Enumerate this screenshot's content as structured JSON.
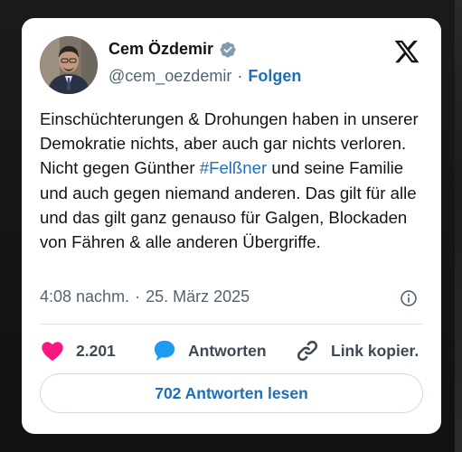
{
  "tweet": {
    "author_name": "Cem Özdemir",
    "handle": "@cem_oezdemir",
    "separator": "·",
    "follow_label": "Folgen",
    "text_before_hashtag": "Einschüchterungen & Drohungen haben in unserer Demokratie nichts, aber auch gar nichts verloren. Nicht gegen Günther ",
    "hashtag": "#Felßner",
    "text_after_hashtag": " und seine Familie und auch gegen niemand anderen. Das gilt für alle und das gilt ganz genauso für Galgen, Blockaden von Fähren & alle anderen Übergriffe.",
    "time": "4:08 nachm.",
    "date": "25. März 2025"
  },
  "actions": {
    "like_count": "2.201",
    "reply_label": "Antworten",
    "link_label": "Link kopier."
  },
  "read_replies_label": "702 Antworten lesen",
  "colors": {
    "accent": "#1d6fb8",
    "like": "#f91880",
    "verified": "#829aab",
    "text": "#0f1419",
    "muted": "#536471"
  },
  "icons": [
    "verified-badge-icon",
    "x-logo-icon",
    "info-icon",
    "heart-icon",
    "reply-bubble-icon",
    "link-icon"
  ]
}
